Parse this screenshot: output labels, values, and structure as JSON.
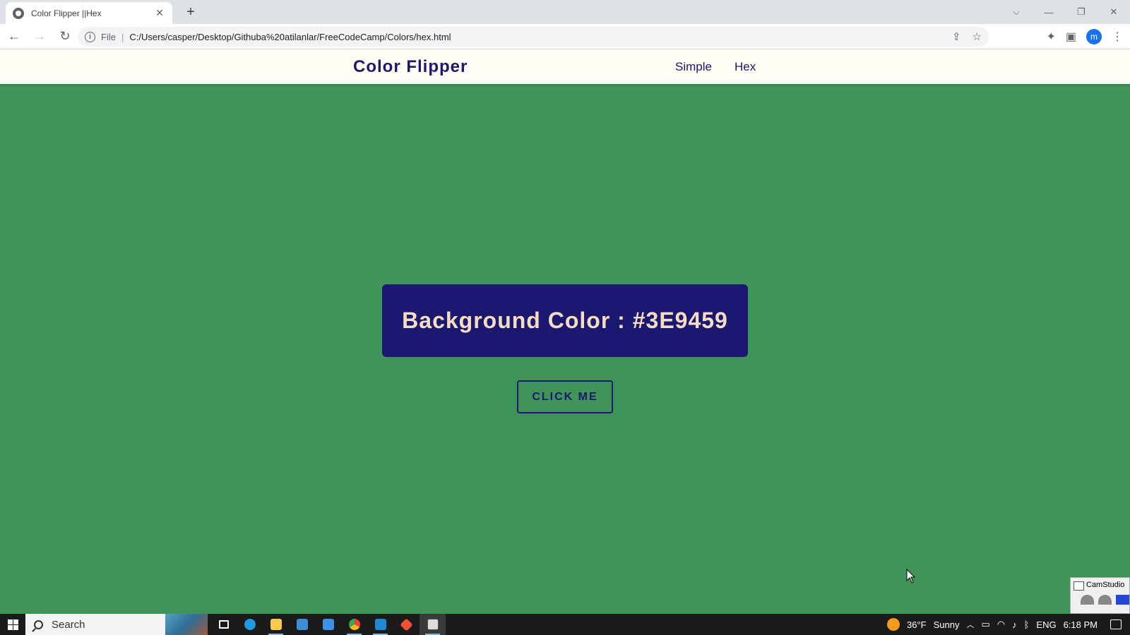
{
  "browser": {
    "tab_title": "Color Flipper ||Hex",
    "tab_close": "✕",
    "new_tab": "+",
    "scheme_label": "File",
    "url": "C:/Users/casper/Desktop/Githuba%20atilanlar/FreeCodeCamp/Colors/hex.html",
    "profile_initial": "m"
  },
  "site": {
    "brand": "Color Flipper",
    "nav": [
      {
        "label": "Simple"
      },
      {
        "label": "Hex"
      }
    ]
  },
  "main": {
    "color_label": "Background Color : #3E9459",
    "button_label": "CLICK ME",
    "background_color": "#3E9459",
    "accent_color": "#1A1870",
    "text_color": "#F6DCC0"
  },
  "camstudio": {
    "title": "CamStudio"
  },
  "taskbar": {
    "search_label": "Search",
    "weather_temp": "36°F",
    "weather_text": "Sunny",
    "language": "ENG",
    "time": "6:18 PM"
  }
}
